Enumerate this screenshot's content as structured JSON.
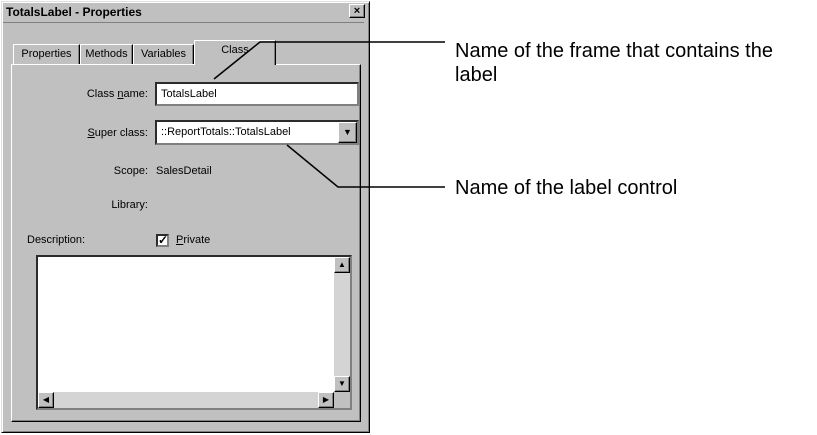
{
  "window": {
    "title": "TotalsLabel - Properties",
    "close_glyph": "×"
  },
  "tabs": [
    {
      "label": "Properties"
    },
    {
      "label": "Methods"
    },
    {
      "label": "Variables"
    },
    {
      "label": "Class",
      "active": true
    }
  ],
  "form": {
    "class_name_label": "Class name:",
    "class_name_value": "TotalsLabel",
    "super_class_label": "Super class:",
    "super_class_value": "::ReportTotals::TotalsLabel",
    "scope_label": "Scope:",
    "scope_value": "SalesDetail",
    "library_label": "Library:",
    "description_label": "Description:",
    "private_label": "Private",
    "private_checked": true
  },
  "callouts": {
    "frame_name": "Name of the frame that contains the label",
    "control_name": "Name of the label control"
  }
}
